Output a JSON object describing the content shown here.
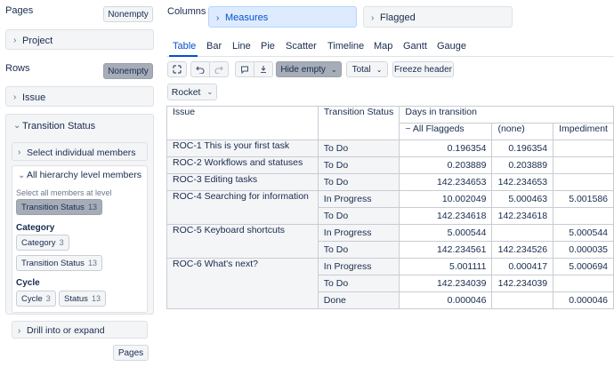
{
  "left": {
    "pages_title": "Pages",
    "pages_nonempty": "Nonempty",
    "project_label": "Project",
    "rows_title": "Rows",
    "rows_nonempty": "Nonempty",
    "issue_label": "Issue",
    "transition_status_label": "Transition Status",
    "select_individual": "Select individual members",
    "all_hierarchy": "All hierarchy level members",
    "select_all_at_level": "Select all members at level",
    "ts_chip": {
      "label": "Transition Status",
      "count": "13"
    },
    "category_title": "Category",
    "category_chips": [
      {
        "label": "Category",
        "count": "3"
      },
      {
        "label": "Transition Status",
        "count": "13"
      }
    ],
    "cycle_title": "Cycle",
    "cycle_chips": [
      {
        "label": "Cycle",
        "count": "3"
      },
      {
        "label": "Status",
        "count": "13"
      }
    ],
    "drill_label": "Drill into or expand",
    "pages_button": "Pages"
  },
  "columns": {
    "title": "Columns",
    "measures": "Measures",
    "flagged": "Flagged"
  },
  "tabs": [
    "Table",
    "Bar",
    "Line",
    "Pie",
    "Scatter",
    "Timeline",
    "Map",
    "Gantt",
    "Gauge"
  ],
  "toolbar": {
    "hide_empty": "Hide empty",
    "total": "Total",
    "freeze_header": "Freeze header",
    "theme": "Rocket"
  },
  "table": {
    "header": {
      "issue": "Issue",
      "transition_status": "Transition Status",
      "days_in_transition": "Days in transition",
      "all_flaggeds": "All Flaggeds",
      "none": "(none)",
      "impediment": "Impediment"
    },
    "issues": [
      "ROC-1 This is your first task",
      "ROC-2 Workflows and statuses",
      "ROC-3 Editing tasks",
      "ROC-4 Searching for information",
      "ROC-5 Keyboard shortcuts",
      "ROC-6 What's next?"
    ],
    "rows": [
      {
        "status": "To Do",
        "all": "0.196354",
        "none": "0.196354",
        "imp": ""
      },
      {
        "status": "To Do",
        "all": "0.203889",
        "none": "0.203889",
        "imp": ""
      },
      {
        "status": "To Do",
        "all": "142.234653",
        "none": "142.234653",
        "imp": ""
      },
      {
        "status": "In Progress",
        "all": "10.002049",
        "none": "5.000463",
        "imp": "5.001586"
      },
      {
        "status": "To Do",
        "all": "142.234618",
        "none": "142.234618",
        "imp": ""
      },
      {
        "status": "In Progress",
        "all": "5.000544",
        "none": "",
        "imp": "5.000544"
      },
      {
        "status": "To Do",
        "all": "142.234561",
        "none": "142.234526",
        "imp": "0.000035"
      },
      {
        "status": "In Progress",
        "all": "5.001111",
        "none": "0.000417",
        "imp": "5.000694"
      },
      {
        "status": "To Do",
        "all": "142.234039",
        "none": "142.234039",
        "imp": ""
      },
      {
        "status": "Done",
        "all": "0.000046",
        "none": "",
        "imp": "0.000046"
      }
    ]
  }
}
